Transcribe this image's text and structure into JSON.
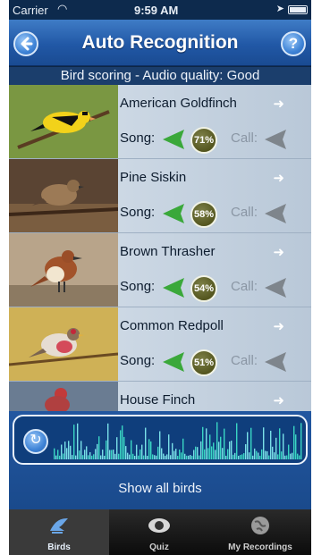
{
  "status": {
    "carrier": "Carrier",
    "time": "9:59 AM"
  },
  "header": {
    "title": "Auto Recognition",
    "back_icon": "left-arrow-icon",
    "help_icon": "question-mark-icon",
    "help_label": "?"
  },
  "subtitle": "Bird scoring - Audio quality: Good",
  "labels": {
    "song": "Song:",
    "call": "Call:"
  },
  "birds": [
    {
      "name": "American Goldfinch",
      "song_score": "71%"
    },
    {
      "name": "Pine Siskin",
      "song_score": "58%"
    },
    {
      "name": "Brown Thrasher",
      "song_score": "54%"
    },
    {
      "name": "Common Redpoll",
      "song_score": "51%"
    },
    {
      "name": "House Finch",
      "song_score": ""
    }
  ],
  "show_all": "Show all birds",
  "tabs": [
    {
      "label": "Birds",
      "icon": "bird-icon",
      "active": true
    },
    {
      "label": "Quiz",
      "icon": "eye-icon",
      "active": false
    },
    {
      "label": "My Recordings",
      "icon": "globe-icon",
      "active": false
    }
  ],
  "colors": {
    "accent": "#2158a6",
    "song_horn": "#3aa83a",
    "badge": "#54561f"
  }
}
